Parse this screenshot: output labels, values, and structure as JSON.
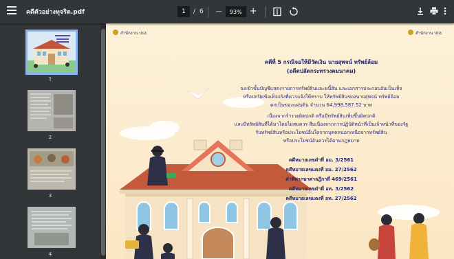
{
  "toolbar": {
    "filename": "คดีตัวอย่างทุจริต.pdf",
    "current_page": "1",
    "page_separator": "/",
    "total_pages": "6",
    "zoom": "93%",
    "zoom_out": "—",
    "zoom_in": "+"
  },
  "sidebar": {
    "thumbnails": [
      {
        "number": "1",
        "selected": true
      },
      {
        "number": "2",
        "selected": false
      },
      {
        "number": "3",
        "selected": false
      },
      {
        "number": "4",
        "selected": false
      }
    ]
  },
  "page": {
    "logo_left": "สำนักงาน ปปง.",
    "logo_right": "สำนักงาน ปปง.",
    "title_line1": "คดีที่ 5 กรณีจอให้มีวัดเงิน นายสุพจน์ ทรัพย์ล้อม",
    "title_line2": "(อดีตปลัดกระทรวงคมนาคม)",
    "body": [
      "จงเข้าขั้นบัญชีแสดงรายการทรัพย์สินและหนี้สิน และเอกสารประกอบอันเป็นเท็จ",
      "หรือปกปิดข้อเท็จจริงที่ควรแจ้งให้ทราบ ให้ทรัพย์สินของนายสุพจน์ ทรัพย์ล้อม",
      "ตกเป็นของแผ่นดิน จำนวน 64,998,587.52 บาท",
      "เนื่องจากร่ำรวยผิดปกติ หรือมีทรัพย์สินเพิ่มขึ้นผิดปกติ",
      "และมีทรัพย์สินที่ได้มาโดยไม่สมควร สืบเนื่องจากการปฏิบัติหน้าที่เป็นเจ้าหน้าที่ของรัฐ",
      "รับทรัพย์สินหรือประโยชน์อื่นใดจากบุคคลนอกเหนือจากทรัพย์สิน",
      "หรือประโยชน์อันควรได้ตามกฎหมาย"
    ],
    "citations": [
      "คดีหมายเลขดำที่ อม. 3/2561",
      "คดีหมายเลขแดงที่ อม. 27/2562",
      "คำพิพากษาศาลฎีกาที่ 469/2561",
      "คดีหมายเลขดำที่ อท. 3/2562",
      "คดีหมายเลขแดงที่ อท. 27/2562"
    ]
  },
  "colors": {
    "toolbar_bg": "#323639",
    "viewer_bg": "#525659",
    "page_bg": "#fef2dc",
    "thumb_selected": "#8ab4f8",
    "text_dark_blue": "#1e2470"
  },
  "icons": [
    "menu-icon",
    "fit-page-icon",
    "rotate-icon",
    "download-icon",
    "print-icon",
    "more-vert-icon"
  ]
}
